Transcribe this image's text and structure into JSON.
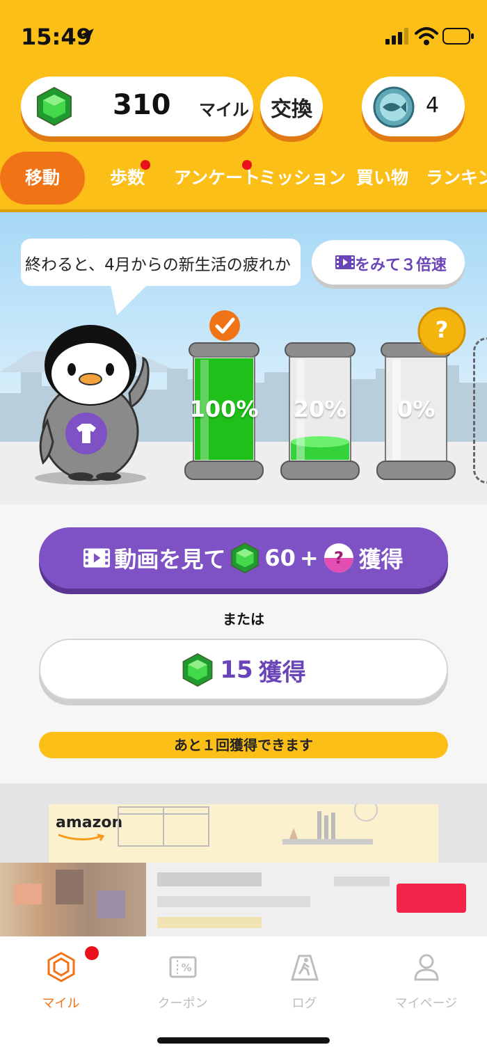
{
  "status_bar": {
    "time": "15:49"
  },
  "header": {
    "miles_value": "310",
    "miles_unit": "マイル",
    "exchange_label": "交換",
    "fish_count": "4"
  },
  "tabs": [
    {
      "label": "移動",
      "active": true,
      "dot": false
    },
    {
      "label": "歩数",
      "active": false,
      "dot": true
    },
    {
      "label": "アンケート",
      "active": false,
      "dot": true
    },
    {
      "label": "ミッション",
      "active": false,
      "dot": false
    },
    {
      "label": "買い物",
      "active": false,
      "dot": false
    },
    {
      "label": "ランキン",
      "active": false,
      "dot": false
    }
  ],
  "scene": {
    "speech_text": "終わると、4月からの新生活の疲れか",
    "speed_button_label": "をみて３倍速",
    "tanks": [
      {
        "percent_label": "100%",
        "fill": 1.0,
        "badge": "check-icon"
      },
      {
        "percent_label": "20%",
        "fill": 0.2,
        "badge": ""
      },
      {
        "percent_label": "0%",
        "fill": 0.0,
        "badge": "question-icon"
      }
    ],
    "question_mark": "?"
  },
  "actions": {
    "video_button": {
      "prefix": "動画を見て",
      "amount": "60",
      "plus": "+",
      "suffix": "獲得"
    },
    "or_text": "または",
    "earn_button": {
      "amount": "15",
      "suffix": "獲得"
    },
    "remaining_text": "あと１回獲得できます"
  },
  "ad": {
    "brand": "amazon"
  },
  "bottom_nav": [
    {
      "label": "マイル",
      "icon": "hexagon-gem-icon",
      "active": true
    },
    {
      "label": "クーポン",
      "icon": "coupon-icon",
      "active": false
    },
    {
      "label": "ログ",
      "icon": "walking-log-icon",
      "active": false
    },
    {
      "label": "マイページ",
      "icon": "person-icon",
      "active": false
    }
  ],
  "colors": {
    "header_bg": "#fbbf17",
    "accent_orange": "#f07316",
    "purple": "#7e52c4",
    "tank_green": "#27c21f",
    "notif_red": "#e8111b"
  }
}
